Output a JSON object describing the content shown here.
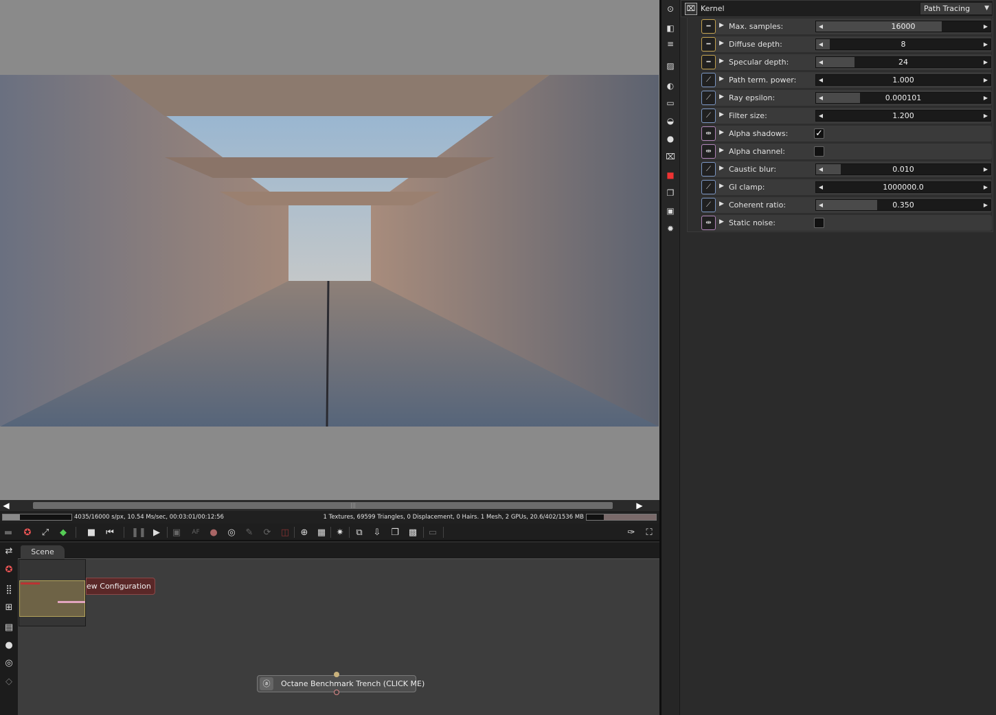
{
  "viewer": {
    "scroll_left": "◀",
    "scroll_right": "▶",
    "scroll_grip": "|||",
    "render_progress": 0.25
  },
  "statusbar": {
    "render_stats": "4035/16000 s/px, 10.54 Ms/sec, 00:03:01/00:12:56",
    "scene_stats": "1 Textures, 69599 Triangles, 0 Displacement, 0 Hairs. 1 Mesh, 2 GPUs, 20.6/402/1536 MB"
  },
  "graph": {
    "tab": "Scene",
    "node_config_label": "ew Configuration",
    "node_trench_label": "Octane Benchmark Trench (CLICK ME)"
  },
  "kernel": {
    "title": "Kernel",
    "type": "Path Tracing",
    "rows": [
      {
        "label": "Max. samples:",
        "value": "16000",
        "kind": "int",
        "fill": 0.72
      },
      {
        "label": "Diffuse depth:",
        "value": "8",
        "kind": "int",
        "fill": 0.08
      },
      {
        "label": "Specular depth:",
        "value": "24",
        "kind": "int",
        "fill": 0.22
      },
      {
        "label": "Path term. power:",
        "value": "1.000",
        "kind": "float",
        "fill": 0.0
      },
      {
        "label": "Ray epsilon:",
        "value": "0.000101",
        "kind": "float",
        "fill": 0.25
      },
      {
        "label": "Filter size:",
        "value": "1.200",
        "kind": "float",
        "fill": 0.0
      },
      {
        "label": "Alpha shadows:",
        "checked": true,
        "kind": "bool"
      },
      {
        "label": "Alpha channel:",
        "checked": false,
        "kind": "bool"
      },
      {
        "label": "Caustic blur:",
        "value": "0.010",
        "kind": "float",
        "fill": 0.14
      },
      {
        "label": "GI clamp:",
        "value": "1000000.0",
        "kind": "float",
        "fill": 0.0
      },
      {
        "label": "Coherent ratio:",
        "value": "0.350",
        "kind": "float",
        "fill": 0.35
      },
      {
        "label": "Static noise:",
        "checked": false,
        "kind": "bool"
      }
    ]
  },
  "colors": {
    "int_badge": "#c3a24e",
    "float_badge": "#7a95c2",
    "bool_badge": "#b084b8",
    "config_node": "#5a2828"
  }
}
